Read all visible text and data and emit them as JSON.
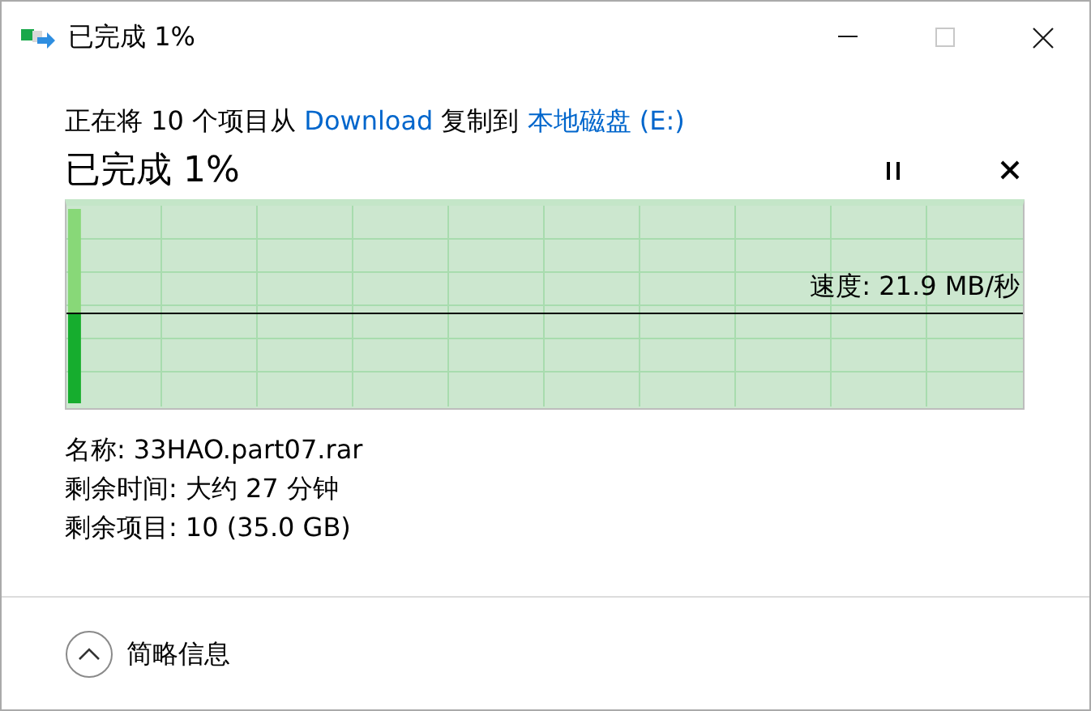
{
  "window": {
    "title": "已完成 1%"
  },
  "title_buttons": [
    {
      "kind": "minimize",
      "disabled": false
    },
    {
      "kind": "maximize",
      "disabled": true
    },
    {
      "kind": "close",
      "disabled": false
    }
  ],
  "summary": [
    {
      "text": "正在将 10 个项目从 ",
      "link": false
    },
    {
      "text": "Download",
      "link": true
    },
    {
      "text": " 复制到 ",
      "link": false
    },
    {
      "text": "本地磁盘 (E:)",
      "link": true
    }
  ],
  "heading": "已完成 1%",
  "progress": {
    "level": 0.01,
    "speed": "速度: 21.9 MB/秒"
  },
  "details": [
    {
      "label": "名称:",
      "value": "33HAO.part07.rar"
    },
    {
      "label": "剩余时间:",
      "value": "大约 27 分钟"
    },
    {
      "label": "剩余项目:",
      "value": "10 (35.0 GB)"
    }
  ],
  "footer": {
    "toggle": "简略信息",
    "expanded": true
  }
}
